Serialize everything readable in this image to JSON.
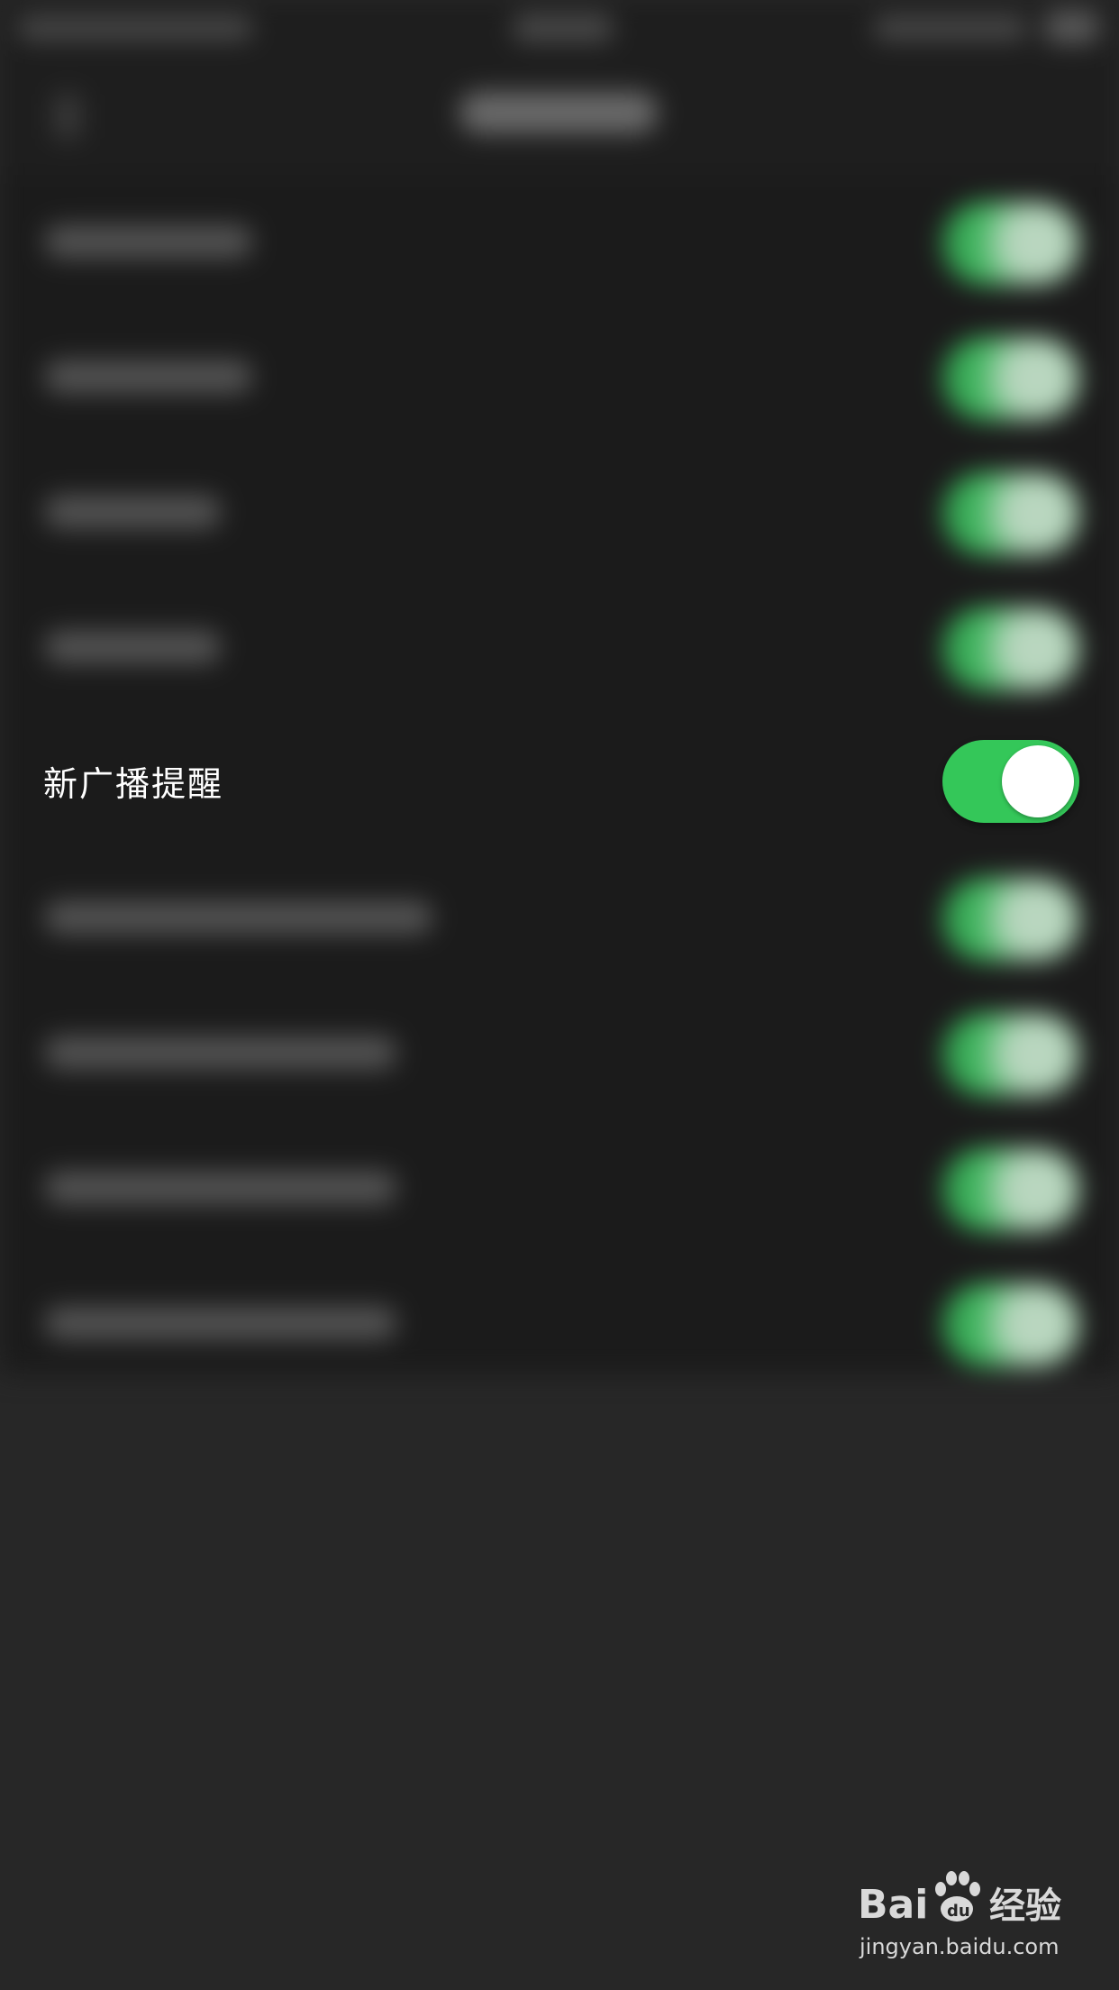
{
  "settings": {
    "focused_item": {
      "label": "新广播提醒",
      "enabled": true
    }
  },
  "colors": {
    "toggle_on": "#34c759",
    "background": "#1b1b1b"
  },
  "watermark": {
    "brand_text": "Bai经验",
    "url_text": "jingyan.baidu.com"
  },
  "icons": [
    "back-arrow-icon",
    "baidu-paw-icon"
  ]
}
